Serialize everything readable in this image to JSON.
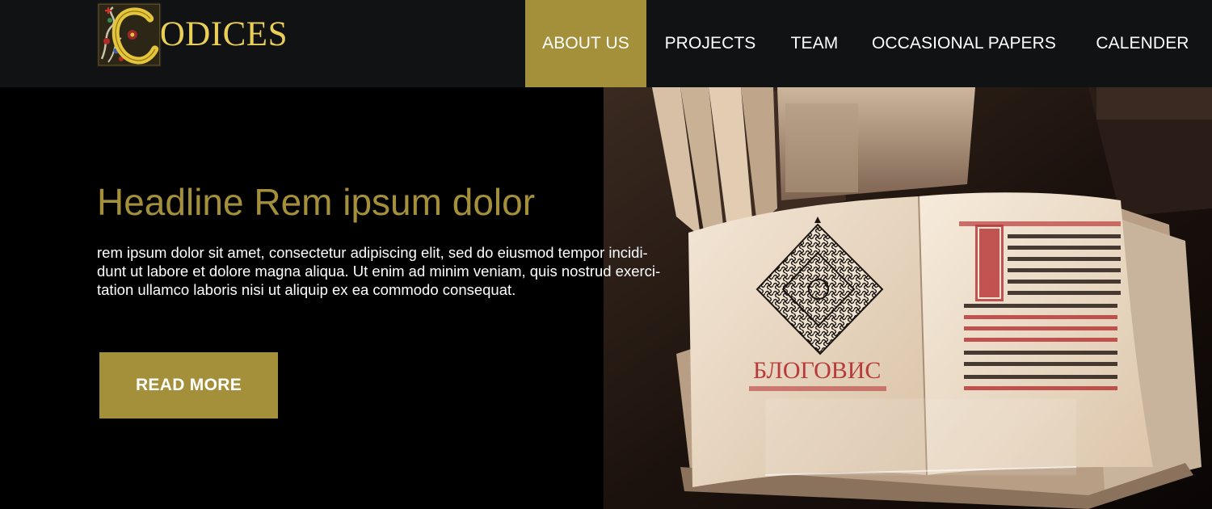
{
  "brand": {
    "initial": "C",
    "rest": "ODICES",
    "accent_color": "#a48f3b",
    "logo_color": "#e9cf58"
  },
  "nav": {
    "items": [
      {
        "label": "ABOUT US",
        "active": true
      },
      {
        "label": "PROJECTS",
        "active": false
      },
      {
        "label": "TEAM",
        "active": false
      },
      {
        "label": "OCCASIONAL PAPERS",
        "active": false
      },
      {
        "label": "CALENDER",
        "active": false
      }
    ]
  },
  "hero": {
    "headline": "Headline Rem ipsum dolor",
    "body_lines": [
      "rem ipsum dolor sit amet, consectetur adipiscing elit, sed do eiusmod tempor incidi-",
      "dunt ut labore et dolore magna aliqua. Ut enim ad minim veniam, quis nostrud exerci-",
      "tation ullamco laboris nisi ut aliquip ex ea commodo consequat."
    ],
    "button_label": "READ MORE",
    "image_subject": "open-manuscript-book-photo"
  }
}
